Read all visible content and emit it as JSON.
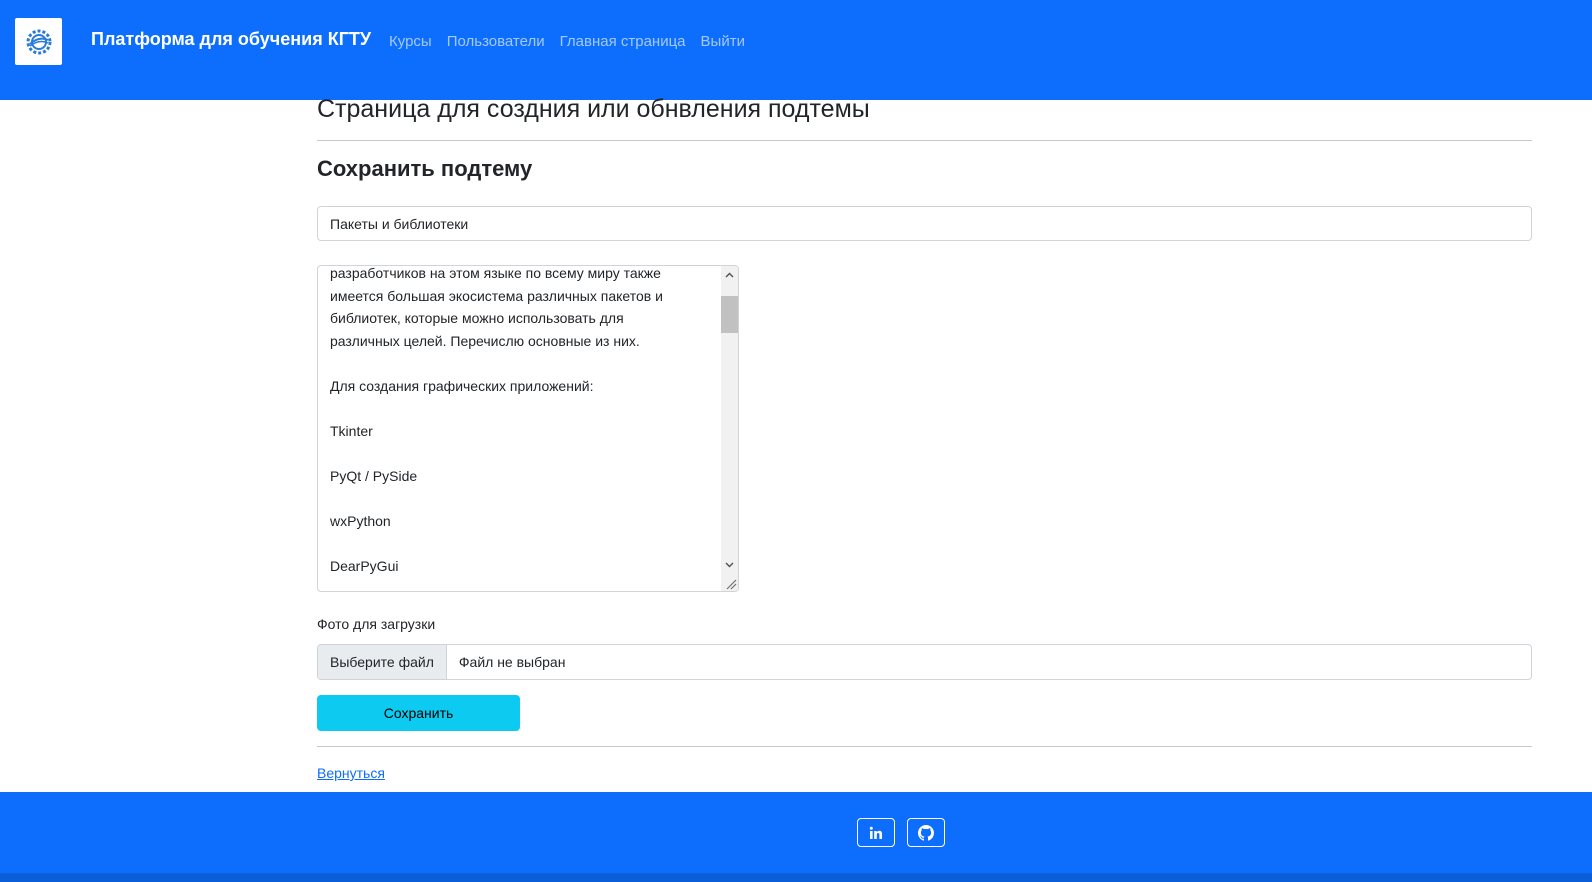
{
  "navbar": {
    "brand": "Платформа для обучения КГТУ",
    "links": [
      "Курсы",
      "Пользователи",
      "Главная страница",
      "Выйти"
    ]
  },
  "page": {
    "title": "Страница для создния или обнвления подтемы",
    "section_title": "Сохранить подтему"
  },
  "form": {
    "name_value": "Пакеты и библиотеки",
    "content_lines": [
      "разработчиков на этом языке по всему миру также",
      "имеется большая экосистема различных пакетов и",
      "библиотек, которые можно использовать для",
      "различных целей. Перечислю основные из них.",
      "",
      "Для создания графических приложений:",
      "",
      "Tkinter",
      "",
      "PyQt / PySide",
      "",
      "wxPython",
      "",
      "DearPyGui"
    ],
    "file_label": "Фото для загрузки",
    "file_button": "Выберите файл",
    "file_status": "Файл не выбран",
    "save_label": "Сохранить"
  },
  "back_link": "Вернуться",
  "footer": {
    "icons": [
      "linkedin-icon",
      "github-icon"
    ]
  },
  "colors": {
    "primary": "#0d6efd",
    "info_button": "#0dcaf0"
  }
}
